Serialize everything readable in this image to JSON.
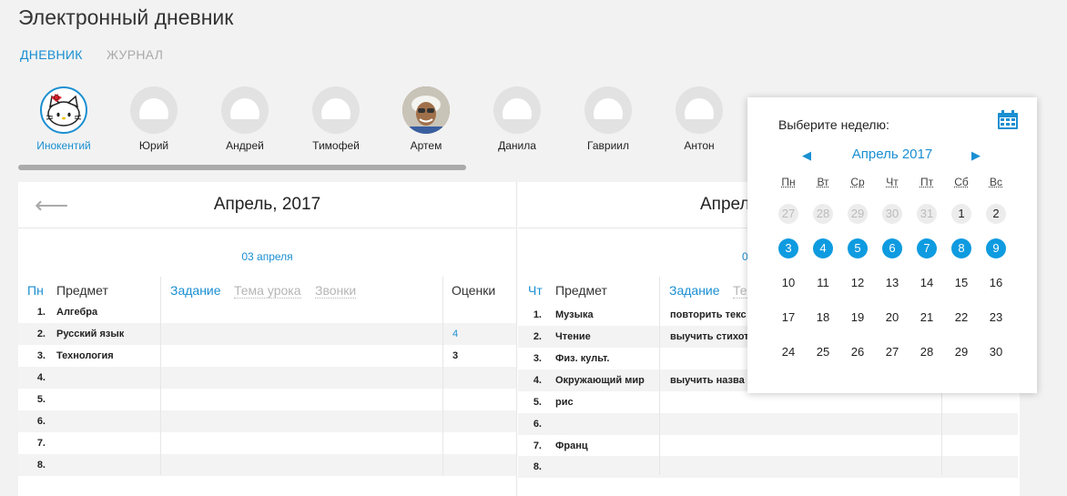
{
  "app": {
    "title": "Электронный дневник"
  },
  "nav": {
    "tab_diary": "ДНЕВНИК",
    "tab_journal": "ЖУРНАЛ"
  },
  "students": [
    {
      "name": "Инокентий"
    },
    {
      "name": "Юрий"
    },
    {
      "name": "Андрей"
    },
    {
      "name": "Тимофей"
    },
    {
      "name": "Артем"
    },
    {
      "name": "Данила"
    },
    {
      "name": "Гавриил"
    },
    {
      "name": "Антон"
    }
  ],
  "week": {
    "month_left": "Апрель, 2017",
    "month_right": "Апрел",
    "back_arrow": "⟵",
    "left": {
      "date": "03 апреля",
      "day_abbr": "Пн",
      "h_subject": "Предмет",
      "h_task": "Задание",
      "h_topic": "Тема урока",
      "h_bells": "Звонки",
      "h_grades": "Оценки",
      "rows": [
        {
          "num": "1.",
          "subject": "Алгебра",
          "task": "",
          "grade": ""
        },
        {
          "num": "2.",
          "subject": "Русский язык",
          "task": "",
          "grade": "4"
        },
        {
          "num": "3.",
          "subject": "Технология",
          "task": "",
          "grade": "3"
        },
        {
          "num": "4.",
          "subject": "",
          "task": "",
          "grade": ""
        },
        {
          "num": "5.",
          "subject": "",
          "task": "",
          "grade": ""
        },
        {
          "num": "6.",
          "subject": "",
          "task": "",
          "grade": ""
        },
        {
          "num": "7.",
          "subject": "",
          "task": "",
          "grade": ""
        },
        {
          "num": "8.",
          "subject": "",
          "task": "",
          "grade": ""
        }
      ]
    },
    "right": {
      "date": "0",
      "day_abbr": "Чт",
      "h_subject": "Предмет",
      "h_task": "Задание",
      "h_topic": "Те",
      "rows": [
        {
          "num": "1.",
          "subject": "Музыка",
          "task": "повторить текс"
        },
        {
          "num": "2.",
          "subject": "Чтение",
          "task": "выучить стихот"
        },
        {
          "num": "3.",
          "subject": "Физ. культ.",
          "task": ""
        },
        {
          "num": "4.",
          "subject": "Окружающий мир",
          "task": "выучить назва"
        },
        {
          "num": "5.",
          "subject": "рис",
          "task": ""
        },
        {
          "num": "6.",
          "subject": "",
          "task": ""
        },
        {
          "num": "7.",
          "subject": "Франц",
          "task": ""
        },
        {
          "num": "8.",
          "subject": "",
          "task": ""
        }
      ]
    }
  },
  "calendar": {
    "title": "Выберите неделю:",
    "month": "Апрель 2017",
    "prev": "◀",
    "next": "▶",
    "weekdays": [
      "Пн",
      "Вт",
      "Ср",
      "Чт",
      "Пт",
      "Сб",
      "Вс"
    ],
    "weeks": [
      [
        {
          "d": "27",
          "s": "out"
        },
        {
          "d": "28",
          "s": "out"
        },
        {
          "d": "29",
          "s": "out"
        },
        {
          "d": "30",
          "s": "out"
        },
        {
          "d": "31",
          "s": "out"
        },
        {
          "d": "1",
          "s": "gray"
        },
        {
          "d": "2",
          "s": "gray"
        }
      ],
      [
        {
          "d": "3",
          "s": "sel"
        },
        {
          "d": "4",
          "s": "sel"
        },
        {
          "d": "5",
          "s": "sel"
        },
        {
          "d": "6",
          "s": "sel"
        },
        {
          "d": "7",
          "s": "sel"
        },
        {
          "d": "8",
          "s": "sel"
        },
        {
          "d": "9",
          "s": "sel"
        }
      ],
      [
        {
          "d": "10",
          "s": ""
        },
        {
          "d": "11",
          "s": ""
        },
        {
          "d": "12",
          "s": ""
        },
        {
          "d": "13",
          "s": ""
        },
        {
          "d": "14",
          "s": ""
        },
        {
          "d": "15",
          "s": ""
        },
        {
          "d": "16",
          "s": ""
        }
      ],
      [
        {
          "d": "17",
          "s": ""
        },
        {
          "d": "18",
          "s": ""
        },
        {
          "d": "19",
          "s": ""
        },
        {
          "d": "20",
          "s": ""
        },
        {
          "d": "21",
          "s": ""
        },
        {
          "d": "22",
          "s": ""
        },
        {
          "d": "23",
          "s": ""
        }
      ],
      [
        {
          "d": "24",
          "s": ""
        },
        {
          "d": "25",
          "s": ""
        },
        {
          "d": "26",
          "s": ""
        },
        {
          "d": "27",
          "s": ""
        },
        {
          "d": "28",
          "s": ""
        },
        {
          "d": "29",
          "s": ""
        },
        {
          "d": "30",
          "s": ""
        }
      ]
    ]
  },
  "colors": {
    "accent": "#1a8fd1",
    "selected_week": "#0e9be0"
  }
}
